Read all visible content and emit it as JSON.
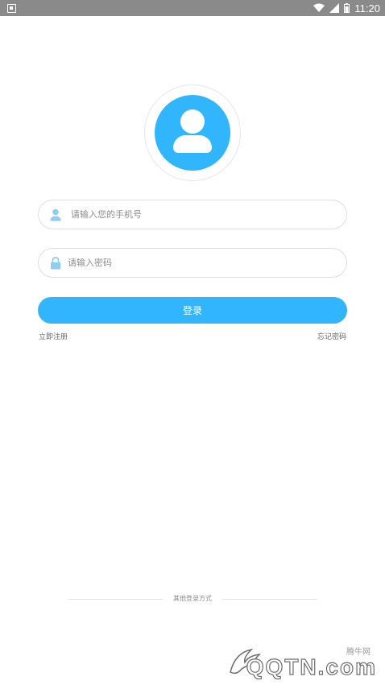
{
  "status_bar": {
    "time": "11:20",
    "icons": [
      "notification-icon",
      "wifi-icon",
      "cellular-signal-icon",
      "battery-icon"
    ]
  },
  "login": {
    "phone_placeholder": "请输入您的手机号",
    "password_placeholder": "请输入密码",
    "login_button": "登录",
    "register_link": "立即注册",
    "forgot_link": "忘记密码"
  },
  "other_login": {
    "label": "其他登录方式"
  },
  "watermark": {
    "chinese": "腾牛网",
    "brand": "QQTN.com"
  },
  "colors": {
    "accent": "#31b5fc",
    "status_bar": "#8a8a8a",
    "field_icon": "#8fcdf2"
  }
}
